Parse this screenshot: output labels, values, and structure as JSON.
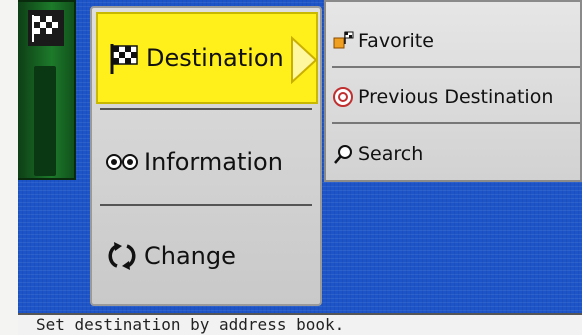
{
  "main_menu": {
    "items": [
      {
        "label": "Destination",
        "icon": "checkered-flag-icon",
        "selected": true
      },
      {
        "label": "Information",
        "icon": "eyes-icon",
        "selected": false
      },
      {
        "label": "Change",
        "icon": "rotate-arrows-icon",
        "selected": false
      }
    ]
  },
  "sub_menu": {
    "items": [
      {
        "label": "Favorite",
        "icon": "favorite-flag-icon"
      },
      {
        "label": "Previous Destination",
        "icon": "previous-destination-icon"
      },
      {
        "label": "Search",
        "icon": "search-icon"
      }
    ]
  },
  "status_bar": {
    "message": "Set destination by address book."
  },
  "colors": {
    "map_background": "#1d55c8",
    "selected_item": "#ffef1a",
    "side_tab": "#1d7a2a"
  }
}
